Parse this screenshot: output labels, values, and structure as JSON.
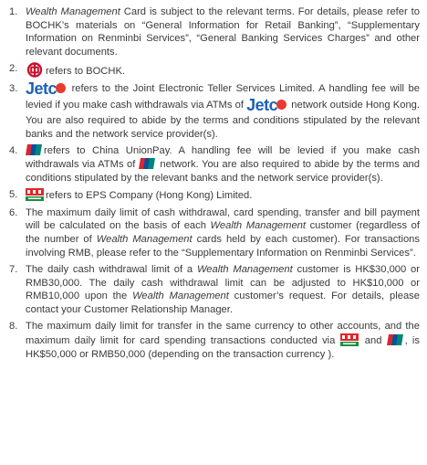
{
  "notes": [
    {
      "number": "1.",
      "p1": "Wealth Management",
      "p2": " Card is subject to the relevant terms. For details, please refer to BOCHK’s materials on “General Information for Retail Banking”, “Supplementary Information on Renminbi Services”, “General Banking Services Charges” and other relevant documents."
    },
    {
      "number": "2.",
      "p1": "refers to BOCHK.",
      "icon": "boc-logo-icon"
    },
    {
      "number": "3.",
      "logo_text": "Jetc",
      "p1": "refers to the Joint Electronic Teller Services Limited. A handling fee will be levied if you make cash withdrawals via ATMs of ",
      "p2": "network outside Hong Kong. You are also required to abide by the terms and conditions stipulated by the relevant banks and the network service provider(s)."
    },
    {
      "number": "4.",
      "p1": "refers to China UnionPay. A handling fee will be levied if you make cash withdrawals via ATMs of ",
      "p2": " network. You are also required to abide by the terms and conditions stipulated by the relevant banks and the network service provider(s).",
      "icon": "unionpay-logo-icon"
    },
    {
      "number": "5.",
      "p1": "refers to EPS Company (Hong Kong) Limited.",
      "icon": "eps-logo-icon"
    },
    {
      "number": "6.",
      "p1": "The maximum daily limit of cash withdrawal, card spending, transfer and bill payment will be calculated on the basis of each ",
      "p2": "Wealth Management",
      "p3": " customer (regardless of the number of ",
      "p4": "Wealth Management",
      "p5": " cards held by each customer). For transactions involving RMB, please refer to the “Supplementary Information on Renminbi Services”."
    },
    {
      "number": "7.",
      "p1": "The daily cash withdrawal limit of a ",
      "p2": "Wealth Management",
      "p3": " customer is HK$30,000 or RMB30,000. The daily cash withdrawal limit can be adjusted to HK$10,000 or RMB10,000 upon the ",
      "p4": "Wealth Management",
      "p5": " customer’s request. For details, please contact your Customer Relationship Manager."
    },
    {
      "number": "8.",
      "p1": "The maximum daily limit for transfer in the same currency to other accounts, and the maximum daily limit for card spending transactions conducted via ",
      "p2": " and ",
      "p3": ", is HK$50,000 or RMB50,000 (depending on the transaction currency )."
    }
  ],
  "colors": {
    "text": "#3a3a3a",
    "boc_red": "#c8102e",
    "jetco_blue": "#1c61b7",
    "jetco_red": "#e93a2f",
    "unionpay_red": "#d7282f",
    "unionpay_blue": "#0a4f9c",
    "unionpay_teal": "#00857a",
    "eps_red": "#e3262b",
    "eps_green": "#1a8f3c"
  }
}
